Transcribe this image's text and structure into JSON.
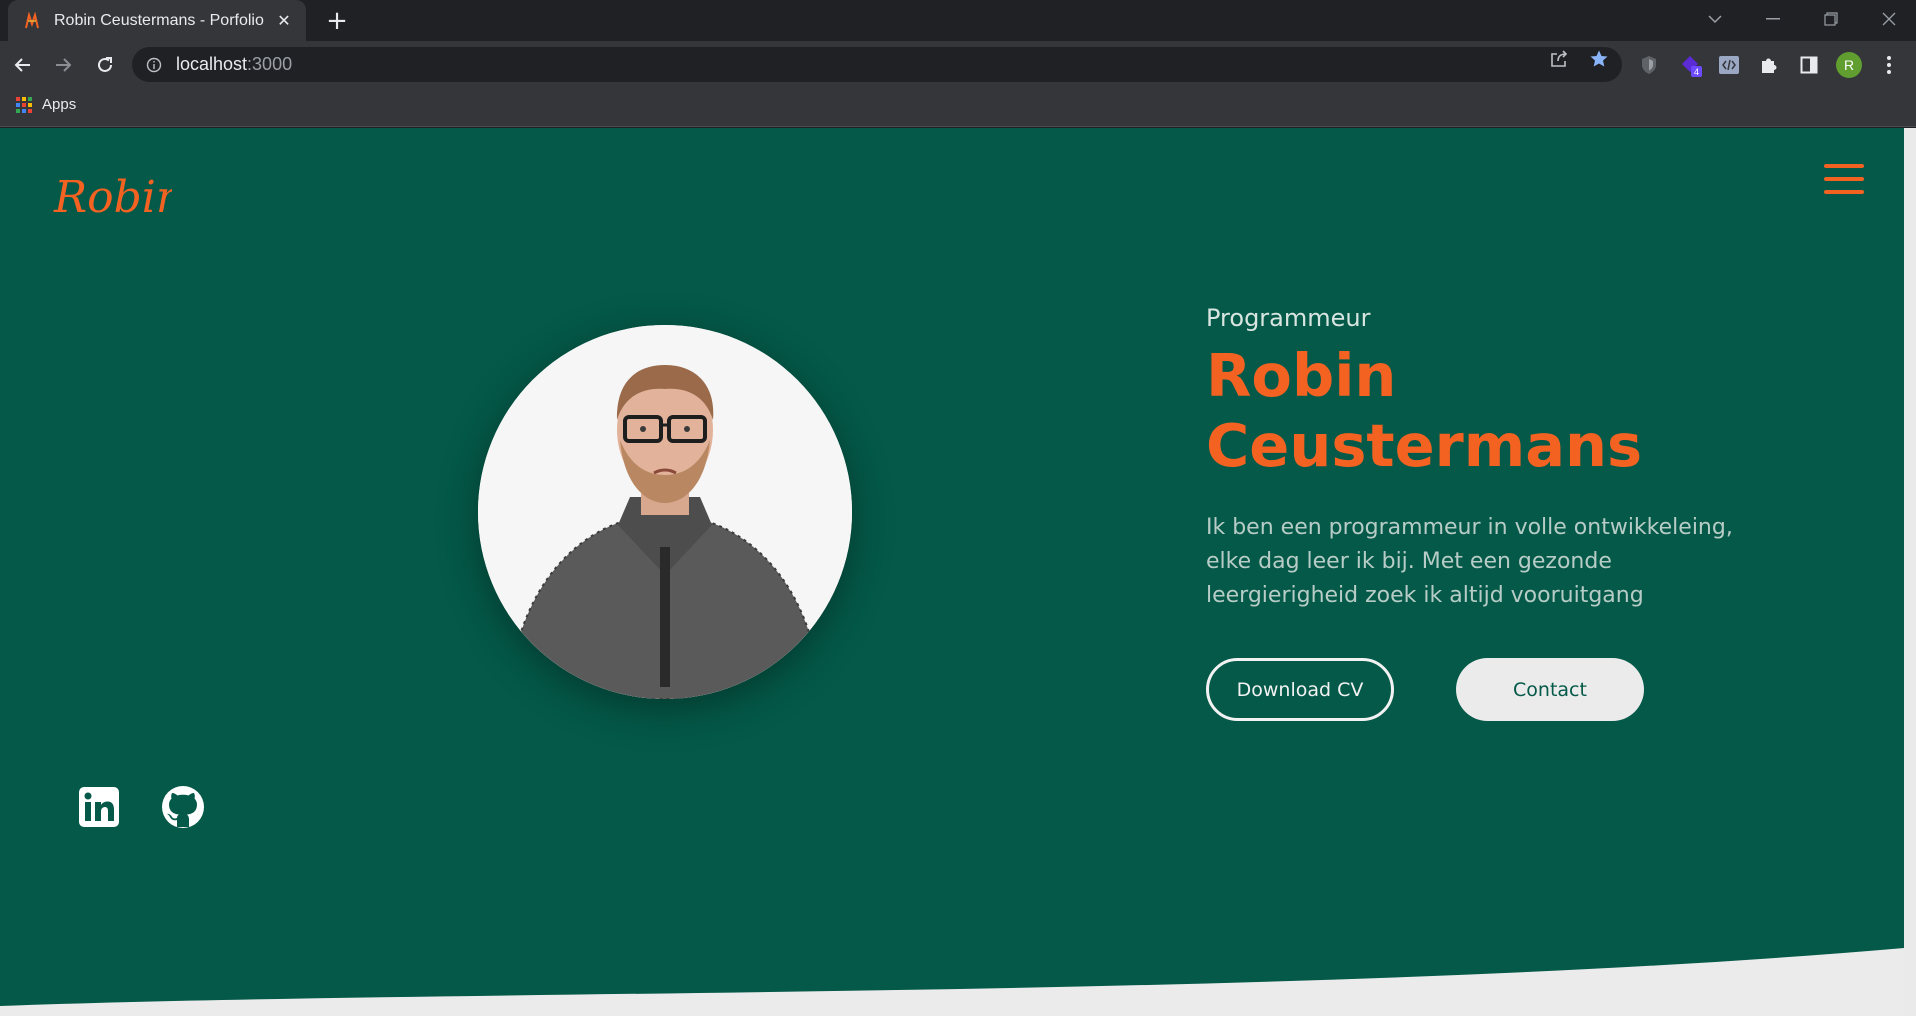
{
  "browser": {
    "tab_title": "Robin Ceustermans - Porfolio",
    "url_host": "localhost",
    "url_port": ":3000",
    "bookmarks": {
      "apps_label": "Apps"
    },
    "extension_badge": "4",
    "profile_initial": "R"
  },
  "page": {
    "logo_text": "Robin",
    "hero": {
      "subtitle": "Programmeur",
      "name_line1": "Robin",
      "name_line2": "Ceustermans",
      "intro": "Ik ben een programmeur in volle ontwikkeleing, elke dag leer ik bij. Met een gezonde leergierigheid zoek ik altijd vooruitgang"
    },
    "buttons": {
      "download_cv": "Download CV",
      "contact": "Contact"
    },
    "social": [
      "linkedin-icon",
      "github-icon"
    ]
  },
  "colors": {
    "background": "#045948",
    "accent": "#f46222",
    "light": "#ebebeb"
  }
}
